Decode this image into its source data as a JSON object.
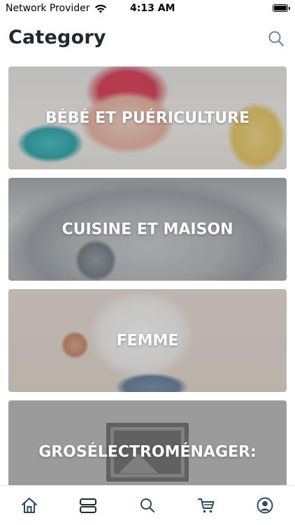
{
  "status": {
    "carrier": "Network Provider",
    "time": "4:13 AM"
  },
  "header": {
    "title": "Category",
    "search_icon": "search-icon"
  },
  "categories": [
    {
      "label": "BÉBÉ ET PUÉRICULTURE"
    },
    {
      "label": "CUISINE ET MAISON"
    },
    {
      "label": "FEMME"
    },
    {
      "label": "GROSÉLECTROMÉNAGER:"
    }
  ],
  "tabs": [
    {
      "name": "home",
      "icon": "home-icon",
      "active": false
    },
    {
      "name": "categories",
      "icon": "category-icon",
      "active": true
    },
    {
      "name": "search",
      "icon": "search-icon",
      "active": false
    },
    {
      "name": "cart",
      "icon": "cart-icon",
      "active": false
    },
    {
      "name": "profile",
      "icon": "profile-icon",
      "active": false
    }
  ],
  "colors": {
    "title": "#1f2a2e",
    "icon": "#2c4a5e",
    "icon_muted": "#6a8a9c"
  }
}
